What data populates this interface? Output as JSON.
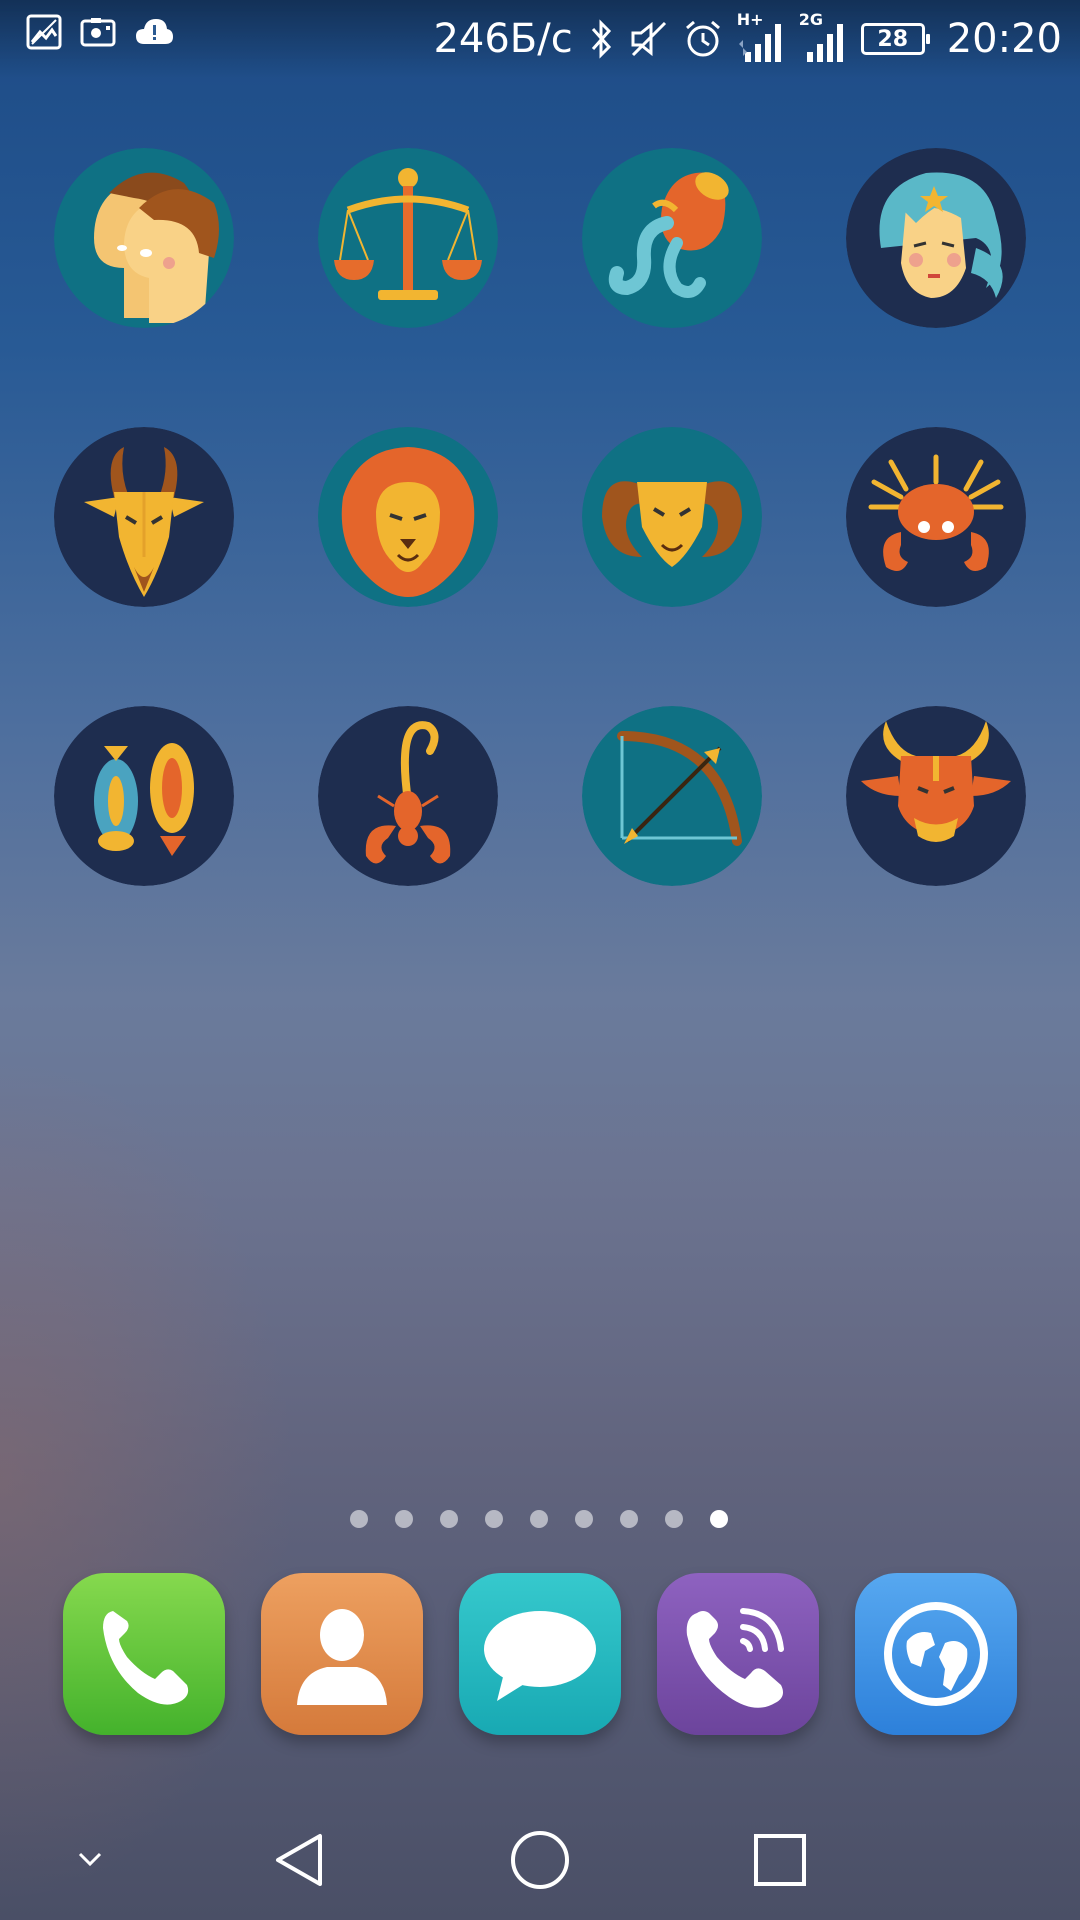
{
  "status_bar": {
    "left_icons": [
      "image-notification-icon",
      "screen-record-icon",
      "cloud-alert-icon"
    ],
    "net_speed": "246Б/с",
    "network1_label": "H+",
    "network2_label": "2G",
    "battery_level": "28",
    "time": "20:20"
  },
  "home": {
    "zodiac_apps": [
      {
        "name": "gemini-icon"
      },
      {
        "name": "libra-icon"
      },
      {
        "name": "aquarius-icon"
      },
      {
        "name": "virgo-icon"
      },
      {
        "name": "capricorn-icon"
      },
      {
        "name": "leo-icon"
      },
      {
        "name": "aries-icon"
      },
      {
        "name": "cancer-icon"
      },
      {
        "name": "pisces-icon"
      },
      {
        "name": "scorpio-icon"
      },
      {
        "name": "sagittarius-icon"
      },
      {
        "name": "taurus-icon"
      }
    ],
    "page_indicator": {
      "total": 9,
      "current": 9
    }
  },
  "dock": {
    "apps": [
      {
        "name": "phone-icon",
        "color": "#5cc23f"
      },
      {
        "name": "contacts-icon",
        "color": "#e0894a"
      },
      {
        "name": "messages-icon",
        "color": "#23b7c0"
      },
      {
        "name": "viber-icon",
        "color": "#7b52ab"
      },
      {
        "name": "browser-icon",
        "color": "#3d92e8"
      }
    ]
  },
  "nav_bar": {
    "buttons": [
      "collapse-icon",
      "back-icon",
      "home-icon",
      "recents-icon"
    ]
  }
}
